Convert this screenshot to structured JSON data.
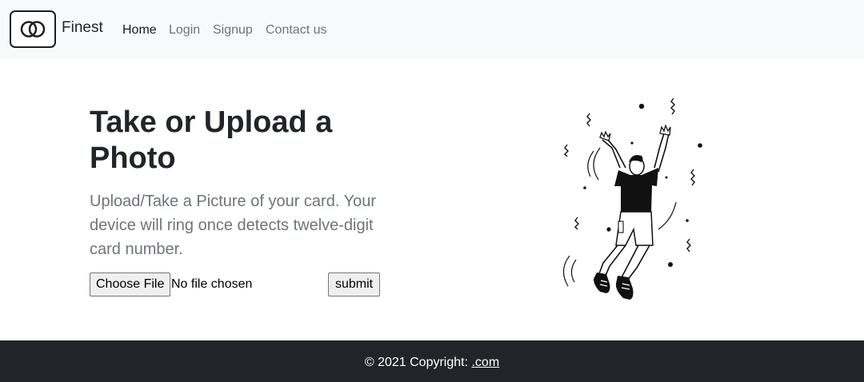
{
  "navbar": {
    "brand": "Finest",
    "logo_icon": "interlocking-rings-logo",
    "links": [
      {
        "label": "Home",
        "active": true
      },
      {
        "label": "Login",
        "active": false
      },
      {
        "label": "Signup",
        "active": false
      },
      {
        "label": "Contact us",
        "active": false
      }
    ]
  },
  "hero": {
    "title": "Take or Upload a Photo",
    "lead": "Upload/Take a Picture of your card. Your device will ring once detects twelve-digit card number.",
    "file_input": {
      "button_label": "Choose File",
      "status": "No file chosen"
    },
    "submit_label": "submit",
    "illustration": "man-jumping-with-raised-arms"
  },
  "footer": {
    "copyright": "© 2021 Copyright: ",
    "link_label": ".com"
  },
  "colors": {
    "navbar_bg": "#f8f9fa",
    "footer_bg": "#212529",
    "muted_text": "#6c757d",
    "body_text": "#212529"
  }
}
